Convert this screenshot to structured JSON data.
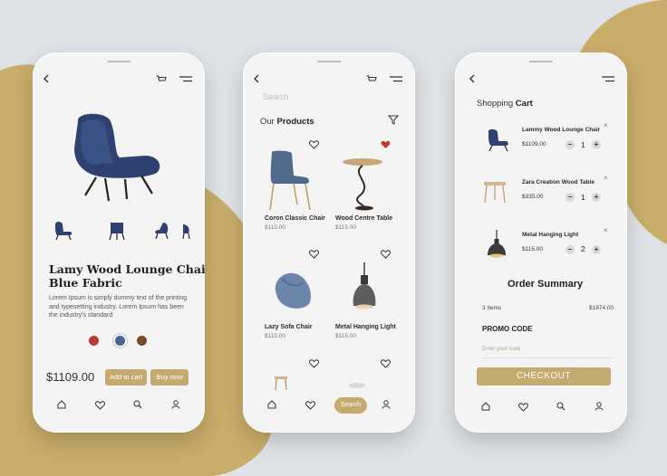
{
  "colors": {
    "background": "#dfe2e6",
    "blob": "#c9ad6a",
    "accent": "#c5ab6f",
    "heart_active": "#c0392b"
  },
  "product_detail": {
    "title_line1": "Lamy Wood Lounge Chair",
    "title_line2": "Blue Fabric",
    "description": "Lorem Ipsum is simply dummy text of the printing and typesetting industry. Lorem Ipsum has been the industry's standard",
    "color_options": [
      "#b8393a",
      "#4b6391",
      "#7a4a2c"
    ],
    "price": "$1109.00",
    "add_to_cart_label": "Add to cart",
    "buy_now_label": "Buy now",
    "icons": [
      "back-arrow-icon",
      "cart-icon",
      "menu-icon"
    ]
  },
  "product_list": {
    "search_placeholder": "Search",
    "section_title_pre": "Our ",
    "section_title_bold": "Products",
    "products": [
      {
        "name": "Coron Classic Chair",
        "price": "$115.00",
        "favorite": false
      },
      {
        "name": "Wood Centre Table",
        "price": "$115.00",
        "favorite": true
      },
      {
        "name": "Lazy Sofa Chair",
        "price": "$115.00",
        "favorite": false
      },
      {
        "name": "Metal Hanging Light",
        "price": "$115.00",
        "favorite": false
      }
    ],
    "search_pill_label": "Search"
  },
  "cart": {
    "title_pre": "Shopping ",
    "title_bold": "Cart",
    "items": [
      {
        "name": "Lammy Wood Lounge Chair",
        "price": "$1109.00",
        "qty": "1",
        "minus": "−",
        "plus": "+",
        "remove": "×"
      },
      {
        "name": "Zara Creation Wood Table",
        "price": "$335.00",
        "qty": "1",
        "minus": "−",
        "plus": "+",
        "remove": "×"
      },
      {
        "name": "Metal Hanging Light",
        "price": "$115.00",
        "qty": "2",
        "minus": "−",
        "plus": "+",
        "remove": "×"
      }
    ],
    "order_summary_title": "Order Summary",
    "items_count": "3 Items",
    "total": "$1874.00",
    "promo_label": "PROMO CODE",
    "promo_placeholder": "Enter your code",
    "checkout_label": "CHECKOUT"
  },
  "bottom_nav_icons": [
    "home-icon",
    "heart-icon",
    "search-icon",
    "profile-icon"
  ]
}
